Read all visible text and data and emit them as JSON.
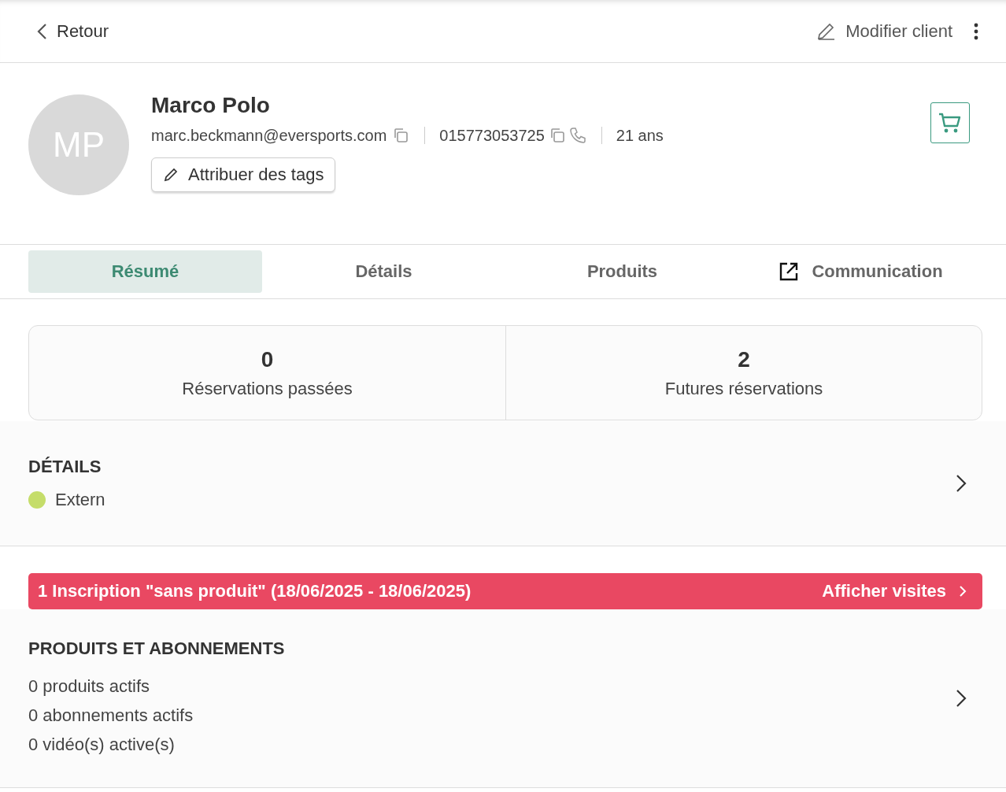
{
  "header": {
    "back_label": "Retour",
    "edit_label": "Modifier client"
  },
  "client": {
    "initials": "MP",
    "name": "Marco Polo",
    "email": "marc.beckmann@eversports.com",
    "phone": "015773053725",
    "age": "21 ans",
    "tags_button": "Attribuer des tags"
  },
  "tabs": [
    {
      "label": "Résumé",
      "selected": true,
      "kind": "plain"
    },
    {
      "label": "Détails",
      "selected": false,
      "kind": "plain"
    },
    {
      "label": "Produits",
      "selected": false,
      "kind": "plain"
    },
    {
      "label": "Communication",
      "selected": false,
      "kind": "external"
    }
  ],
  "stats": [
    {
      "value": "0",
      "label": "Réservations passées"
    },
    {
      "value": "2",
      "label": "Futures réservations"
    }
  ],
  "details": {
    "title": "DÉTAILS",
    "items": [
      {
        "label": "Extern",
        "color": "#c5dd6a"
      }
    ]
  },
  "alert": {
    "text": "1 Inscription \"sans produit\" (18/06/2025 - 18/06/2025)",
    "action": "Afficher visites"
  },
  "products": {
    "title": "PRODUITS ET ABONNEMENTS",
    "lines": [
      "0 produits actifs",
      "0 abonnements actifs",
      "0 vidéo(s) active(s)"
    ]
  }
}
